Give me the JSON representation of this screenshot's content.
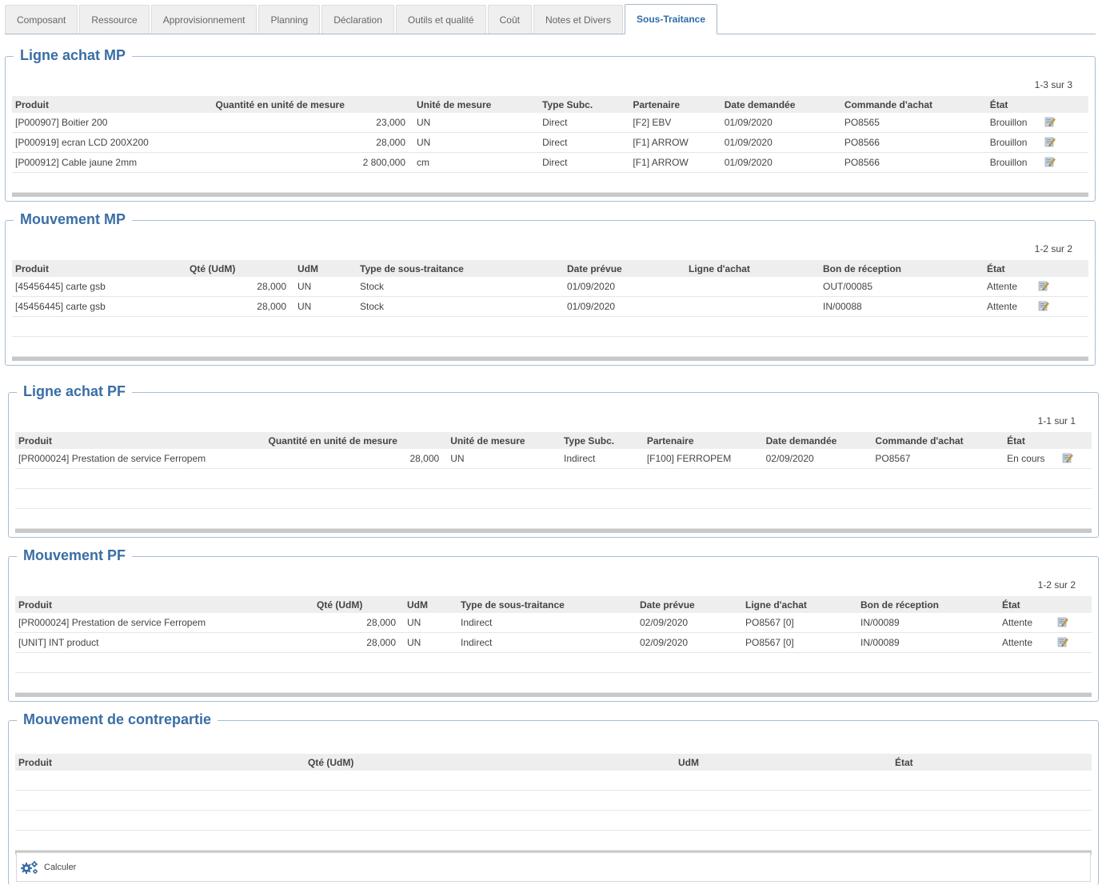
{
  "tabs": [
    "Composant",
    "Ressource",
    "Approvisionnement",
    "Planning",
    "Déclaration",
    "Outils et qualité",
    "Coût",
    "Notes et Divers",
    "Sous-Traitance"
  ],
  "active_tab": "Sous-Traitance",
  "section1": {
    "title": "Ligne achat MP",
    "pager": "1-3 sur 3",
    "headers": [
      "Produit",
      "Quantité en unité de mesure",
      "Unité de mesure",
      "Type Subc.",
      "Partenaire",
      "Date demandée",
      "Commande d'achat",
      "État"
    ],
    "rows": [
      [
        "[P000907] Boitier 200",
        "23,000",
        "UN",
        "Direct",
        "[F2] EBV",
        "01/09/2020",
        "PO8565",
        "Brouillon"
      ],
      [
        "[P000919] ecran LCD 200X200",
        "28,000",
        "UN",
        "Direct",
        "[F1] ARROW",
        "01/09/2020",
        "PO8566",
        "Brouillon"
      ],
      [
        "[P000912] Cable jaune 2mm",
        "2 800,000",
        "cm",
        "Direct",
        "[F1] ARROW",
        "01/09/2020",
        "PO8566",
        "Brouillon"
      ]
    ]
  },
  "section2": {
    "title": "Mouvement MP",
    "pager": "1-2 sur 2",
    "headers": [
      "Produit",
      "Qté (UdM)",
      "UdM",
      "Type de sous-traitance",
      "Date prévue",
      "Ligne d'achat",
      "Bon de réception",
      "État"
    ],
    "rows": [
      [
        "[45456445] carte gsb",
        "28,000",
        "UN",
        "Stock",
        "01/09/2020",
        "",
        "OUT/00085",
        "Attente"
      ],
      [
        "[45456445] carte gsb",
        "28,000",
        "UN",
        "Stock",
        "01/09/2020",
        "",
        "IN/00088",
        "Attente"
      ]
    ]
  },
  "section3": {
    "title": "Ligne achat PF",
    "pager": "1-1 sur 1",
    "headers": [
      "Produit",
      "Quantité en unité de mesure",
      "Unité de mesure",
      "Type Subc.",
      "Partenaire",
      "Date demandée",
      "Commande d'achat",
      "État"
    ],
    "rows": [
      [
        "[PR000024] Prestation de service Ferropem",
        "28,000",
        "UN",
        "Indirect",
        "[F100] FERROPEM",
        "02/09/2020",
        "PO8567",
        "En cours"
      ]
    ]
  },
  "section4": {
    "title": "Mouvement PF",
    "pager": "1-2 sur 2",
    "headers": [
      "Produit",
      "Qté (UdM)",
      "UdM",
      "Type de sous-traitance",
      "Date prévue",
      "Ligne d'achat",
      "Bon de réception",
      "État"
    ],
    "rows": [
      [
        "[PR000024] Prestation de service Ferropem",
        "28,000",
        "UN",
        "Indirect",
        "02/09/2020",
        "PO8567 [0]",
        "IN/00089",
        "Attente"
      ],
      [
        "[UNIT] INT product",
        "28,000",
        "UN",
        "Indirect",
        "02/09/2020",
        "PO8567 [0]",
        "IN/00089",
        "Attente"
      ]
    ]
  },
  "section5": {
    "title": "Mouvement de contrepartie",
    "headers": [
      "Produit",
      "Qté (UdM)",
      "UdM",
      "État"
    ]
  },
  "calc_button": "Calculer",
  "icons": {
    "edit": "edit-pencil-icon",
    "calc": "gears-icon"
  },
  "colors": {
    "accent": "#3a6ea5",
    "border": "#a7bdd4"
  }
}
